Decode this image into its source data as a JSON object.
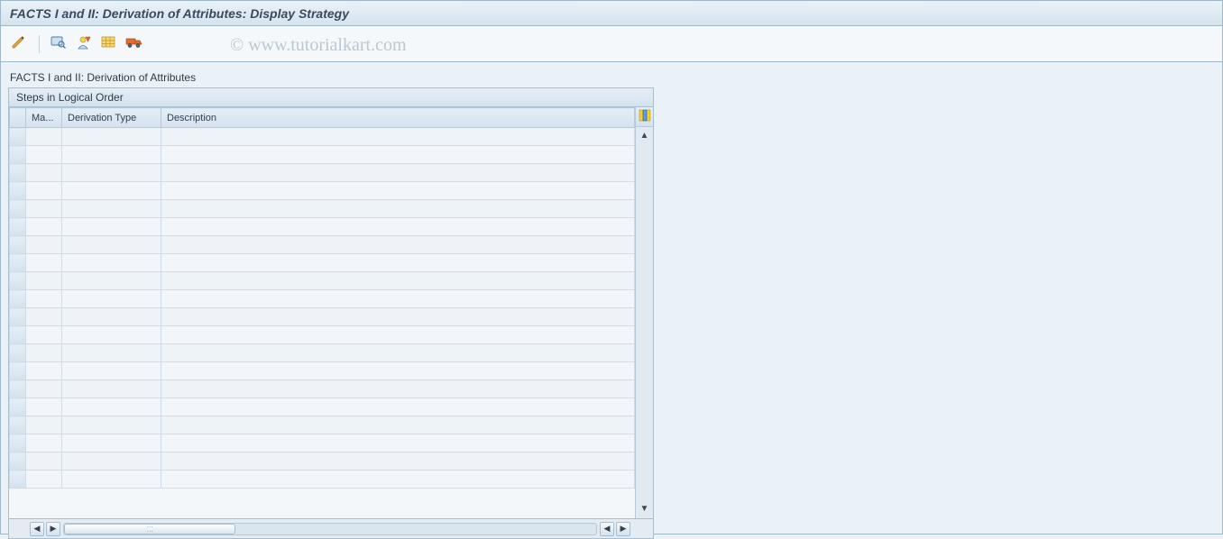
{
  "titlebar": {
    "title": "FACTS I and II: Derivation of Attributes: Display Strategy"
  },
  "toolbar": {
    "icons": {
      "change_display": "change-display-icon",
      "detail": "detail-icon",
      "source_fields": "source-icon",
      "target_fields": "target-icon",
      "transport": "transport-icon"
    }
  },
  "watermark": "© www.tutorialkart.com",
  "content": {
    "subtitle": "FACTS I and II: Derivation of Attributes",
    "panel": {
      "header": "Steps in Logical Order",
      "columns": {
        "col1": "Ma...",
        "col2": "Derivation Type",
        "col3": "Description"
      },
      "rows": [
        {
          "maint": "",
          "type": "",
          "desc": ""
        },
        {
          "maint": "",
          "type": "",
          "desc": ""
        },
        {
          "maint": "",
          "type": "",
          "desc": ""
        },
        {
          "maint": "",
          "type": "",
          "desc": ""
        },
        {
          "maint": "",
          "type": "",
          "desc": ""
        },
        {
          "maint": "",
          "type": "",
          "desc": ""
        },
        {
          "maint": "",
          "type": "",
          "desc": ""
        },
        {
          "maint": "",
          "type": "",
          "desc": ""
        },
        {
          "maint": "",
          "type": "",
          "desc": ""
        },
        {
          "maint": "",
          "type": "",
          "desc": ""
        },
        {
          "maint": "",
          "type": "",
          "desc": ""
        },
        {
          "maint": "",
          "type": "",
          "desc": ""
        },
        {
          "maint": "",
          "type": "",
          "desc": ""
        },
        {
          "maint": "",
          "type": "",
          "desc": ""
        },
        {
          "maint": "",
          "type": "",
          "desc": ""
        },
        {
          "maint": "",
          "type": "",
          "desc": ""
        },
        {
          "maint": "",
          "type": "",
          "desc": ""
        },
        {
          "maint": "",
          "type": "",
          "desc": ""
        },
        {
          "maint": "",
          "type": "",
          "desc": ""
        },
        {
          "maint": "",
          "type": "",
          "desc": ""
        }
      ]
    }
  }
}
